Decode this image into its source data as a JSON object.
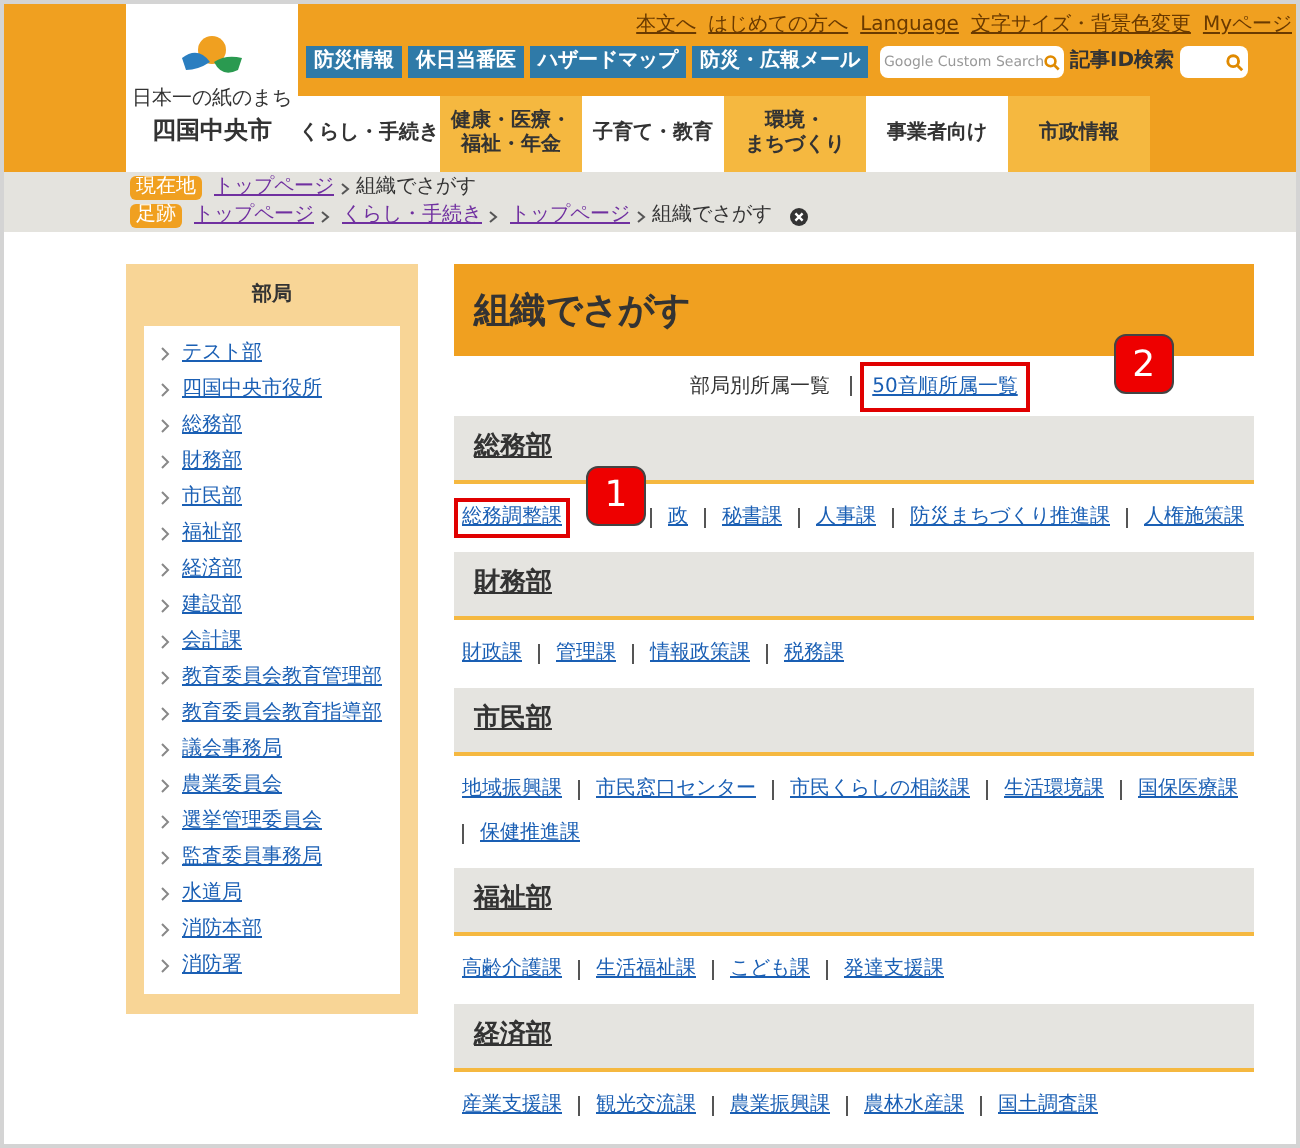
{
  "header": {
    "logo": {
      "tagline": "日本一の紙のまち",
      "name": "四国中央市"
    },
    "top_links": [
      "本文へ",
      "はじめての方へ",
      "Language",
      "文字サイズ・背景色変更",
      "Myページ"
    ],
    "quick_buttons": [
      "防災情報",
      "休日当番医",
      "ハザードマップ",
      "防災・広報メール"
    ],
    "search": {
      "placeholder": "Google Custom Search"
    },
    "id_search": {
      "label": "記事ID検索"
    },
    "nav": [
      {
        "lines": [
          "くらし・手続き"
        ],
        "selected": false
      },
      {
        "lines": [
          "健康・医療・",
          "福祉・年金"
        ],
        "selected": true
      },
      {
        "lines": [
          "子育て・教育"
        ],
        "selected": false
      },
      {
        "lines": [
          "環境・",
          "まちづくり"
        ],
        "selected": true
      },
      {
        "lines": [
          "事業者向け"
        ],
        "selected": false
      },
      {
        "lines": [
          "市政情報"
        ],
        "selected": true
      }
    ]
  },
  "breadcrumbs": [
    {
      "badge": "現在地",
      "links": [
        "トップページ"
      ],
      "current": "組織でさがす",
      "closable": false
    },
    {
      "badge": "足跡",
      "links": [
        "トップページ",
        "くらし・手続き",
        "トップページ"
      ],
      "current": "組織でさがす",
      "closable": true
    }
  ],
  "sidebar": {
    "title": "部局",
    "items": [
      "テスト部",
      "四国中央市役所",
      "総務部",
      "財務部",
      "市民部",
      "福祉部",
      "経済部",
      "建設部",
      "会計課",
      "教育委員会教育管理部",
      "教育委員会教育指導部",
      "議会事務局",
      "農業委員会",
      "選挙管理委員会",
      "監査委員事務局",
      "水道局",
      "消防本部",
      "消防署"
    ]
  },
  "main": {
    "title": "組織でさがす",
    "view_links": [
      {
        "label": "部局別所属一覧",
        "link": false,
        "highlighted": false
      },
      {
        "label": "50音順所属一覧",
        "link": true,
        "highlighted": true,
        "callout": "2"
      }
    ],
    "departments": [
      {
        "name": "総務部",
        "sections": [
          {
            "label": "総務調整課",
            "highlighted": true,
            "callout": "1"
          },
          {
            "label": "政",
            "highlighted": false
          },
          {
            "label": "秘書課",
            "highlighted": false
          },
          {
            "label": "人事課",
            "highlighted": false
          },
          {
            "label": "防災まちづくり推進課",
            "highlighted": false
          },
          {
            "label": "人権施策課",
            "highlighted": false
          }
        ]
      },
      {
        "name": "財務部",
        "sections": [
          {
            "label": "財政課",
            "highlighted": false
          },
          {
            "label": "管理課",
            "highlighted": false
          },
          {
            "label": "情報政策課",
            "highlighted": false
          },
          {
            "label": "税務課",
            "highlighted": false
          }
        ]
      },
      {
        "name": "市民部",
        "sections": [
          {
            "label": "地域振興課",
            "highlighted": false
          },
          {
            "label": "市民窓口センター",
            "highlighted": false
          },
          {
            "label": "市民くらしの相談課",
            "highlighted": false
          },
          {
            "label": "生活環境課",
            "highlighted": false
          },
          {
            "label": "国保医療課",
            "highlighted": false
          },
          {
            "label": "保健推進課",
            "highlighted": false
          }
        ]
      },
      {
        "name": "福祉部",
        "sections": [
          {
            "label": "高齢介護課",
            "highlighted": false
          },
          {
            "label": "生活福祉課",
            "highlighted": false
          },
          {
            "label": "こども課",
            "highlighted": false
          },
          {
            "label": "発達支援課",
            "highlighted": false
          }
        ]
      },
      {
        "name": "経済部",
        "sections": [
          {
            "label": "産業支援課",
            "highlighted": false
          },
          {
            "label": "観光交流課",
            "highlighted": false
          },
          {
            "label": "農業振興課",
            "highlighted": false
          },
          {
            "label": "農林水産課",
            "highlighted": false
          },
          {
            "label": "国土調査課",
            "highlighted": false
          }
        ]
      }
    ]
  }
}
